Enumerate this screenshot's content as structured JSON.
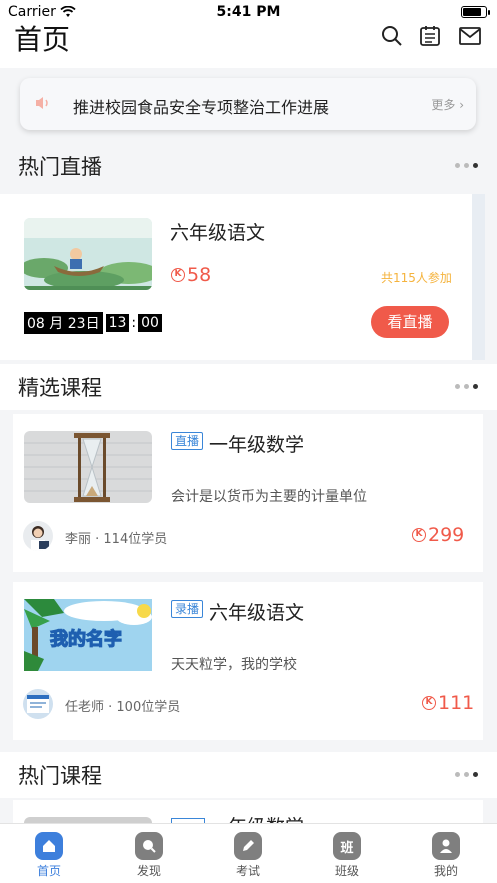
{
  "status_bar": {
    "carrier": "Carrier",
    "time": "5:41 PM"
  },
  "header": {
    "title": "首页"
  },
  "notice": {
    "text": "推进校园食品安全专项整治工作进展",
    "more": "更多 ›"
  },
  "sections": {
    "hot_live": "热门直播",
    "featured": "精选课程",
    "hot_courses": "热门课程"
  },
  "live": {
    "title": "六年级语文",
    "price": "58",
    "participants": "共115人参加",
    "countdown": {
      "month": "08",
      "month_unit": "月",
      "day": "23",
      "day_unit": "日",
      "hour": "13",
      "sep": ":",
      "minute": "00"
    },
    "button": "看直播"
  },
  "courses": [
    {
      "tag": "直播",
      "title": "一年级数学",
      "desc": "会计是以货币为主要的计量单位",
      "teacher": "李丽 · 114位学员",
      "price": "299"
    },
    {
      "tag": "录播",
      "title": "六年级语文",
      "desc": "天天粒学，我的学校",
      "teacher": "任老师 · 100位学员",
      "price": "111"
    }
  ],
  "hot_partial": {
    "title": "一年级数学"
  },
  "thumb2_text": "我的名字",
  "currency_symbol": "K",
  "tabs": [
    {
      "label": "首页",
      "icon": "home-icon",
      "active": true
    },
    {
      "label": "发现",
      "icon": "discover-icon",
      "active": false
    },
    {
      "label": "考试",
      "icon": "exam-icon",
      "active": false
    },
    {
      "label": "班级",
      "icon": "class-icon",
      "active": false,
      "glyph": "班"
    },
    {
      "label": "我的",
      "icon": "profile-icon",
      "active": false
    }
  ],
  "colors": {
    "accent": "#f05a4a",
    "primary": "#3d7fdc",
    "tag": "#3a86d8",
    "count": "#f5b33d"
  }
}
